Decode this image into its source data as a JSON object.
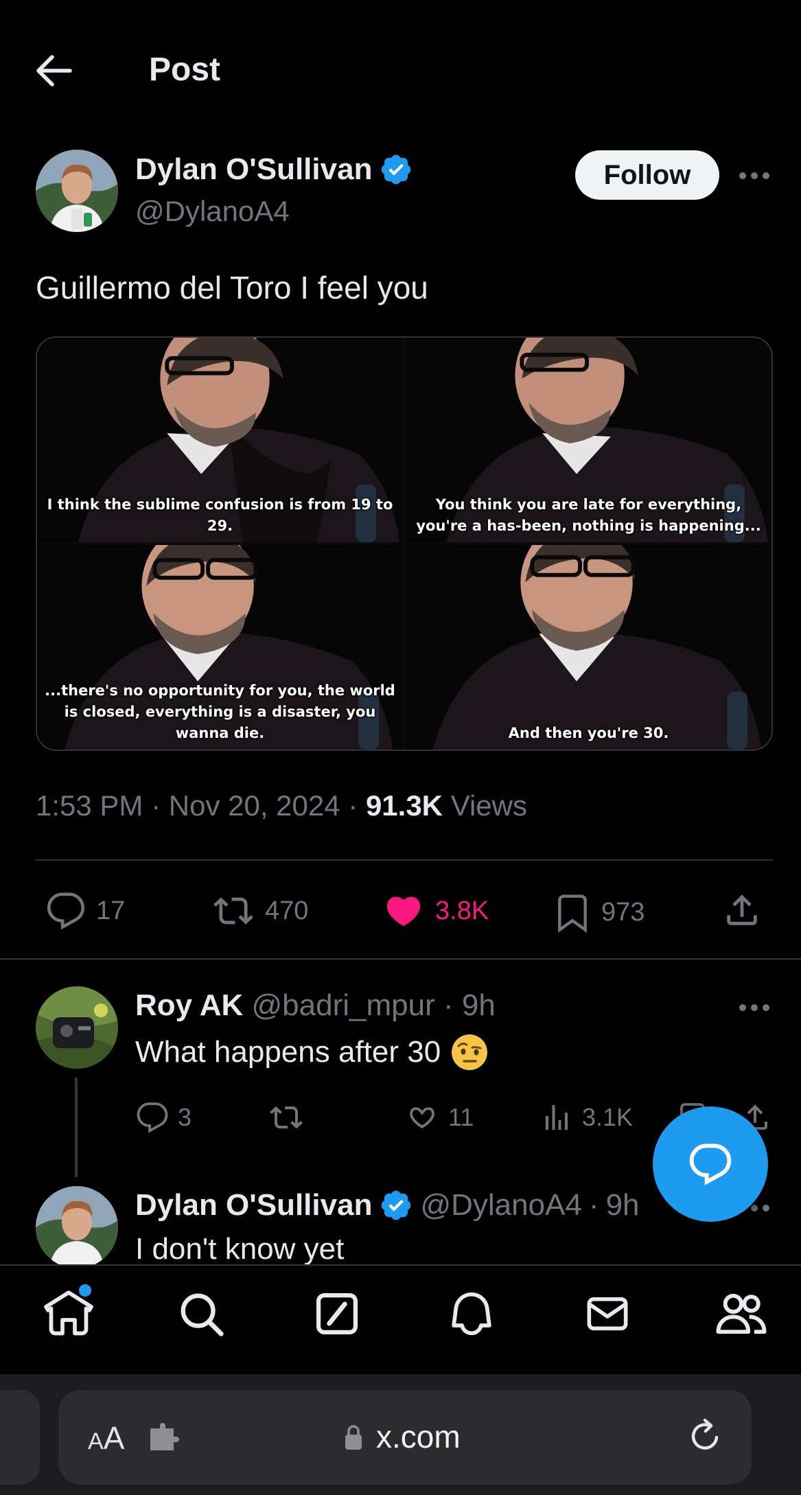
{
  "header": {
    "title": "Post",
    "back_icon": "arrow-left-icon"
  },
  "post": {
    "author_name": "Dylan O'Sullivan",
    "author_handle": "@DylanoA4",
    "verified": true,
    "follow_label": "Follow",
    "text": "Guillermo del Toro I feel you",
    "media_captions": [
      "I think the sublime confusion is from 19 to 29.",
      "You think you are late for everything, you're a has-been, nothing is happening...",
      "...there's no opportunity for you, the world is closed, everything is a disaster, you wanna die.",
      "And then you're 30."
    ],
    "meta": {
      "time": "1:53 PM",
      "date": "Nov 20, 2024",
      "views_count": "91.3K",
      "views_label": "Views"
    },
    "stats": {
      "replies": "17",
      "reposts": "470",
      "likes": "3.8K",
      "bookmarks": "973"
    }
  },
  "replies": [
    {
      "name": "Roy AK",
      "handle": "@badri_mpur",
      "time": "9h",
      "text": "What happens after 30",
      "emoji": "face-with-raised-eyebrow",
      "stats": {
        "replies": "3",
        "likes": "11",
        "views": "3.1K"
      }
    },
    {
      "name": "Dylan O'Sullivan",
      "handle": "@DylanoA4",
      "time": "9h",
      "text": "I don't know yet",
      "verified": true
    }
  ],
  "nav": {
    "items": [
      "home-icon",
      "search-icon",
      "grok-icon",
      "notifications-icon",
      "messages-icon",
      "communities-icon"
    ],
    "home_has_badge": true
  },
  "browser": {
    "text_size_small": "A",
    "text_size_large": "A",
    "url": "x.com"
  },
  "colors": {
    "accent": "#1d9bf0",
    "like": "#f91880",
    "muted": "#71767b",
    "text": "#e7e9ea",
    "divider": "#2f3336"
  }
}
